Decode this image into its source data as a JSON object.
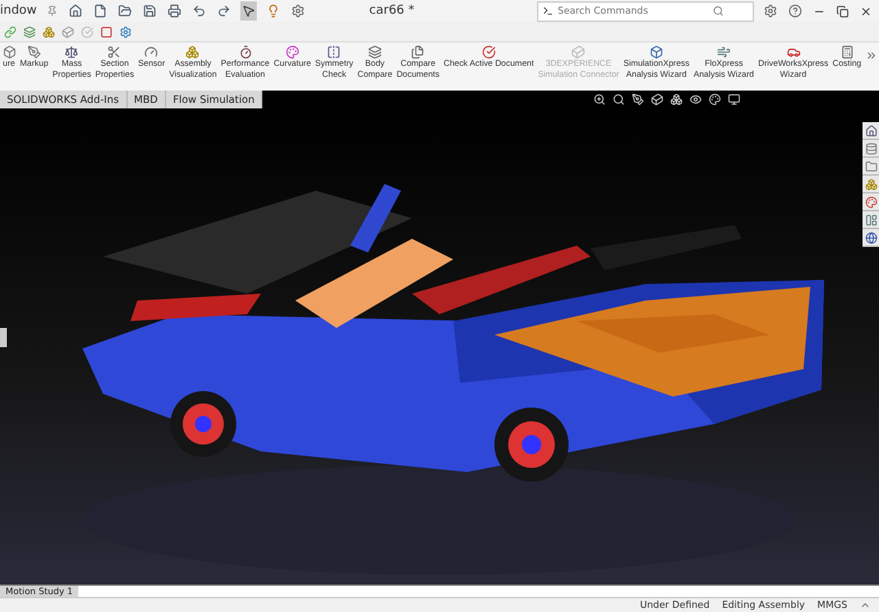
{
  "title_bar": {
    "menu_fragment": "indow",
    "document_title": "car66 *",
    "search": {
      "placeholder": "Search Commands"
    }
  },
  "ribbon": {
    "items": [
      {
        "lines": [
          "ure"
        ],
        "disabled": false
      },
      {
        "lines": [
          "Markup"
        ],
        "disabled": false
      },
      {
        "lines": [
          "Mass",
          "Properties"
        ],
        "disabled": false
      },
      {
        "lines": [
          "Section",
          "Properties"
        ],
        "disabled": false
      },
      {
        "lines": [
          "Sensor"
        ],
        "disabled": false
      },
      {
        "lines": [
          "Assembly",
          "Visualization"
        ],
        "disabled": false
      },
      {
        "lines": [
          "Performance",
          "Evaluation"
        ],
        "disabled": false
      },
      {
        "lines": [
          "Curvature"
        ],
        "disabled": false
      },
      {
        "lines": [
          "Symmetry",
          "Check"
        ],
        "disabled": false
      },
      {
        "lines": [
          "Body",
          "Compare"
        ],
        "disabled": false
      },
      {
        "lines": [
          "Compare",
          "Documents"
        ],
        "disabled": false
      },
      {
        "lines": [
          "Check Active Document"
        ],
        "disabled": false
      },
      {
        "lines": [
          "3DEXPERIENCE",
          "Simulation Connector"
        ],
        "disabled": true
      },
      {
        "lines": [
          "SimulationXpress",
          "Analysis Wizard"
        ],
        "disabled": false
      },
      {
        "lines": [
          "FloXpress",
          "Analysis Wizard"
        ],
        "disabled": false
      },
      {
        "lines": [
          "DriveWorksXpress",
          "Wizard"
        ],
        "disabled": false
      },
      {
        "lines": [
          "Costing"
        ],
        "disabled": false
      }
    ]
  },
  "tabs": [
    {
      "label": "SOLIDWORKS Add-Ins",
      "selected": false
    },
    {
      "label": "MBD",
      "selected": false
    },
    {
      "label": "Flow Simulation",
      "selected": false
    }
  ],
  "bottom_tabs": [
    {
      "label": "Motion Study 1",
      "selected": true
    }
  ],
  "status_bar": {
    "items": [
      "Under Defined",
      "Editing Assembly",
      "MMGS"
    ]
  }
}
